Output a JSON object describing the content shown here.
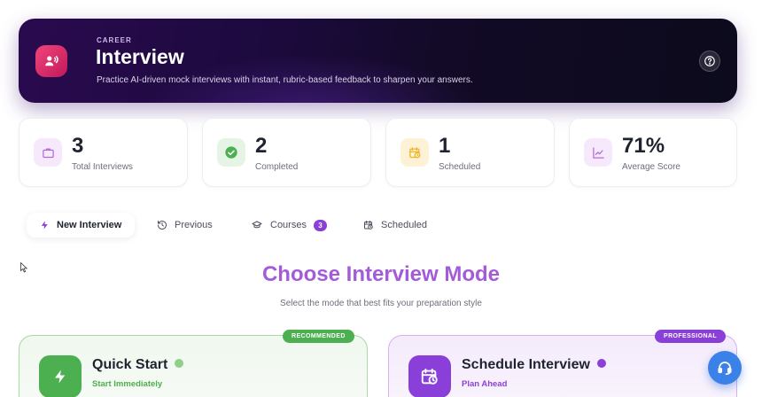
{
  "hero": {
    "kicker": "CAREER",
    "title": "Interview",
    "subtitle": "Practice AI-driven mock interviews with instant, rubric-based feedback to sharpen your answers.",
    "icon": "voice-user-icon",
    "help_icon": "help-icon"
  },
  "stats": [
    {
      "value": "3",
      "label": "Total Interviews",
      "icon": "briefcase-icon",
      "color": "#b56bd6"
    },
    {
      "value": "2",
      "label": "Completed",
      "icon": "check-circle-icon",
      "color": "#4caf50"
    },
    {
      "value": "1",
      "label": "Scheduled",
      "icon": "calendar-clock-icon",
      "color": "#f0b323"
    },
    {
      "value": "71%",
      "label": "Average Score",
      "icon": "trend-chart-icon",
      "color": "#b56bd6"
    }
  ],
  "tabs": [
    {
      "label": "New Interview",
      "icon": "bolt-icon",
      "active": true
    },
    {
      "label": "Previous",
      "icon": "history-icon"
    },
    {
      "label": "Courses",
      "icon": "graduation-cap-icon",
      "badge": "3"
    },
    {
      "label": "Scheduled",
      "icon": "calendar-clock-icon"
    }
  ],
  "section": {
    "title": "Choose Interview Mode",
    "subtitle": "Select the mode that best fits your preparation style"
  },
  "modes": [
    {
      "pill": "RECOMMENDED",
      "title": "Quick Start",
      "subtitle": "Start Immediately",
      "icon": "bolt-icon",
      "color": "#4caf50"
    },
    {
      "pill": "PROFESSIONAL",
      "title": "Schedule Interview",
      "subtitle": "Plan Ahead",
      "icon": "calendar-clock-icon",
      "color": "#8b3fd9"
    }
  ],
  "support": {
    "icon": "headset-icon"
  }
}
